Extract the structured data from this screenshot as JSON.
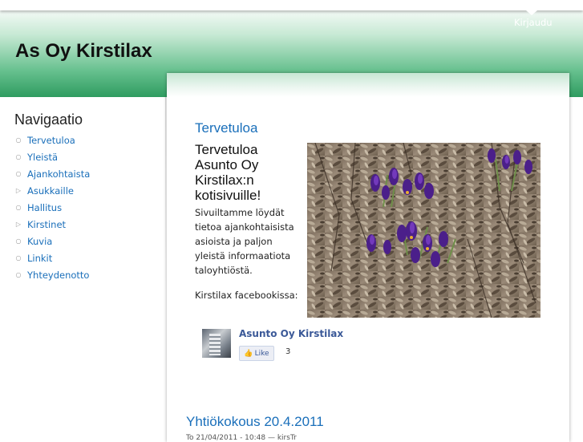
{
  "header": {
    "site_title": "As Oy Kirstilax",
    "login_label": "Kirjaudu"
  },
  "sidebar": {
    "title": "Navigaatio",
    "items": [
      {
        "label": "Tervetuloa",
        "bullet": "○"
      },
      {
        "label": "Yleistä",
        "bullet": "○"
      },
      {
        "label": "Ajankohtaista",
        "bullet": "○"
      },
      {
        "label": "Asukkaille",
        "bullet": "▷"
      },
      {
        "label": "Hallitus",
        "bullet": "○"
      },
      {
        "label": "Kirstinet",
        "bullet": "▷"
      },
      {
        "label": "Kuvia",
        "bullet": "○"
      },
      {
        "label": "Linkit",
        "bullet": "○"
      },
      {
        "label": "Yhteydenotto",
        "bullet": "○"
      }
    ]
  },
  "main": {
    "post_title": "Tervetuloa",
    "welcome_heading": "Tervetuloa Asunto Oy Kirstilax:n kotisivuille!",
    "welcome_text": "Sivuiltamme löydät tietoa ajankohtaisista asioista ja paljon yleistä informaatiota taloyhtiöstä.",
    "facebook_label": "Kirstilax facebookissa:",
    "facebook": {
      "page_name": "Asunto Oy Kirstilax",
      "like_label": "Like",
      "like_count": "3"
    },
    "post2_title": "Yhtiökokous 20.4.2011",
    "post2_meta": "To 21/04/2011 - 10:48 — kirsTr"
  },
  "colors": {
    "link": "#1a6fba",
    "header_green": "#2f9c60",
    "facebook_blue": "#3b5998"
  }
}
